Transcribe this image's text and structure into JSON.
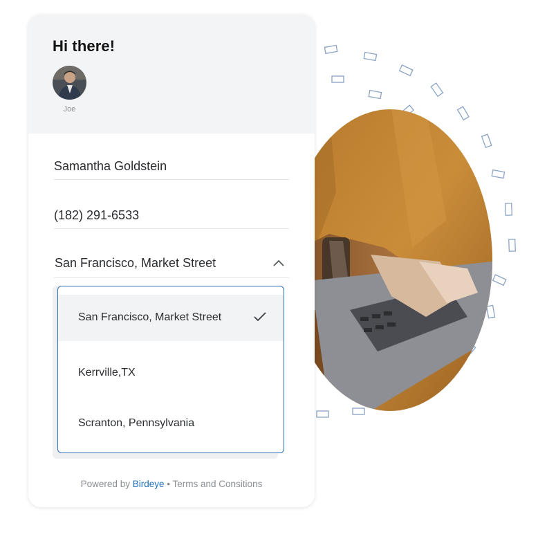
{
  "header": {
    "greeting": "Hi there!",
    "agent_name": "Joe"
  },
  "form": {
    "name_value": "Samantha Goldstein",
    "phone_value": "(182) 291-6533",
    "location_value": "San Francisco, Market Street"
  },
  "dropdown": {
    "options": [
      {
        "label": "San Francisco, Market Street",
        "selected": true
      },
      {
        "label": "Kerrville,TX",
        "selected": false
      },
      {
        "label": "Scranton, Pennsylvania",
        "selected": false
      }
    ]
  },
  "footer": {
    "powered_by": "Powered by",
    "brand": "Birdeye",
    "separator": "•",
    "terms": "Terms and Consitions"
  },
  "icons": {
    "chevron": "chevron-up-icon",
    "check": "check-icon"
  },
  "colors": {
    "accent": "#1f6fbf",
    "dropdown_border": "#2f6fbf",
    "header_bg": "#f3f4f6",
    "text": "#2a2c30",
    "muted": "#8a8d92"
  }
}
